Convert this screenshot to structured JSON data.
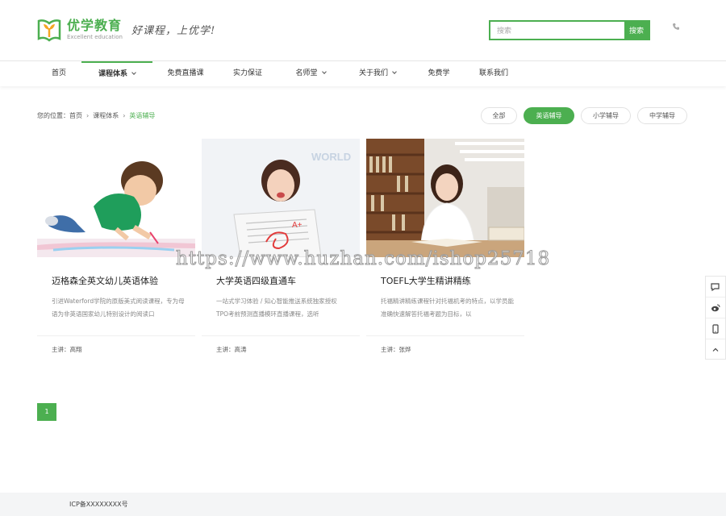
{
  "header": {
    "logo_cn": "优学教育",
    "logo_en": "Excellent education",
    "slogan": "好课程，上优学!",
    "search_placeholder": "搜索",
    "search_button": "搜索"
  },
  "nav": [
    {
      "label": "首页",
      "dropdown": false,
      "active": false
    },
    {
      "label": "课程体系",
      "dropdown": true,
      "active": true
    },
    {
      "label": "免费直播课",
      "dropdown": false,
      "active": false
    },
    {
      "label": "实力保证",
      "dropdown": false,
      "active": false
    },
    {
      "label": "名师堂",
      "dropdown": true,
      "active": false
    },
    {
      "label": "关于我们",
      "dropdown": true,
      "active": false
    },
    {
      "label": "免费学",
      "dropdown": false,
      "active": false
    },
    {
      "label": "联系我们",
      "dropdown": false,
      "active": false
    }
  ],
  "breadcrumb": {
    "prefix": "您的位置：",
    "items": [
      "首页",
      "课程体系"
    ],
    "current": "英语辅导"
  },
  "filters": [
    {
      "label": "全部",
      "active": false
    },
    {
      "label": "英语辅导",
      "active": true
    },
    {
      "label": "小学辅导",
      "active": false
    },
    {
      "label": "中学辅导",
      "active": false
    }
  ],
  "courses": [
    {
      "title": "迈格森全英文幼儿英语体验",
      "desc": "引进Waterford学院的原版美式阅读课程，专为母语为非英语国家幼儿特别设计的阅读口",
      "teacher_label": "主讲：",
      "teacher": "高翔"
    },
    {
      "title": "大学英语四级直通车",
      "desc": "一站式学习体验 / 知心智能推送系统独家授权 TPO考前预测直播模环直播课程，选听",
      "teacher_label": "主讲：",
      "teacher": "高涛",
      "image_text": "WORLD"
    },
    {
      "title": "TOEFL大学生精讲精练",
      "desc": "托福精讲精练课程针对托福机考的特点，以学员能准确快速解答托福考题为目标，以",
      "teacher_label": "主讲：",
      "teacher": "张烨"
    }
  ],
  "watermark": "https://www.huzhan.com/ishop25718",
  "pagination": {
    "current": "1"
  },
  "footer": {
    "icp": "ICP备XXXXXXXX号"
  },
  "colors": {
    "accent": "#4caf50"
  }
}
